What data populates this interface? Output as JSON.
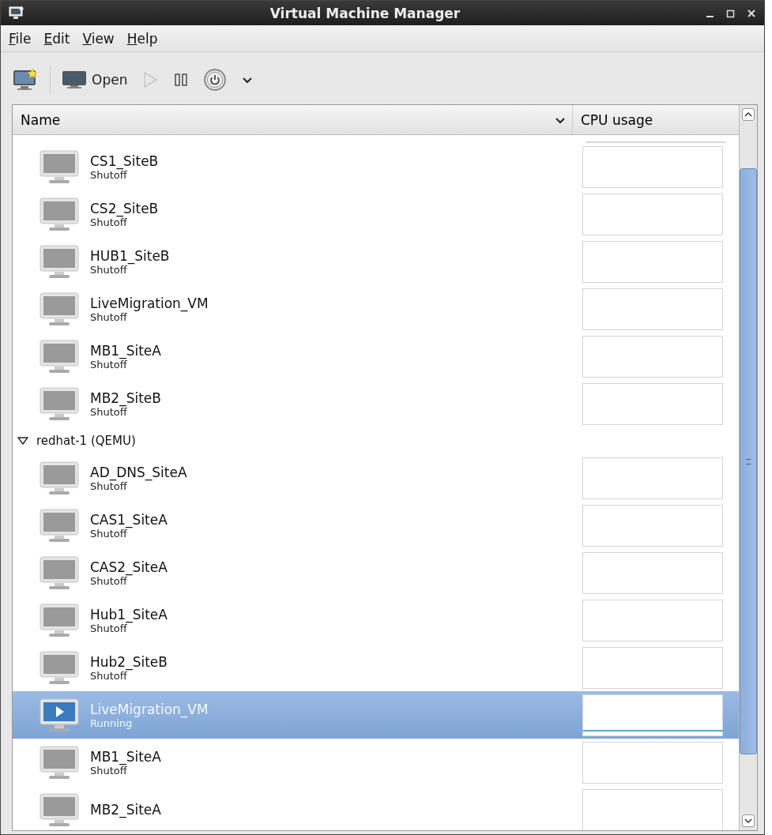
{
  "window": {
    "title": "Virtual Machine Manager"
  },
  "menu": [
    {
      "label": "File"
    },
    {
      "label": "Edit"
    },
    {
      "label": "View"
    },
    {
      "label": "Help"
    }
  ],
  "toolbar": {
    "open_label": "Open",
    "run_disabled": true
  },
  "columns": [
    {
      "label": "Name"
    },
    {
      "label": "CPU usage"
    }
  ],
  "rows": [
    {
      "kind": "vm",
      "name": "CS1_SiteB",
      "status": "Shutoff",
      "running": false,
      "selected": false
    },
    {
      "kind": "vm",
      "name": "CS2_SiteB",
      "status": "Shutoff",
      "running": false,
      "selected": false
    },
    {
      "kind": "vm",
      "name": "HUB1_SiteB",
      "status": "Shutoff",
      "running": false,
      "selected": false
    },
    {
      "kind": "vm",
      "name": "LiveMigration_VM",
      "status": "Shutoff",
      "running": false,
      "selected": false
    },
    {
      "kind": "vm",
      "name": "MB1_SiteA",
      "status": "Shutoff",
      "running": false,
      "selected": false
    },
    {
      "kind": "vm",
      "name": "MB2_SiteB",
      "status": "Shutoff",
      "running": false,
      "selected": false
    },
    {
      "kind": "host",
      "label": "redhat-1 (QEMU)",
      "expanded": true,
      "children": [
        {
          "kind": "vm",
          "name": "AD_DNS_SiteA",
          "status": "Shutoff",
          "running": false,
          "selected": false
        },
        {
          "kind": "vm",
          "name": "CAS1_SiteA",
          "status": "Shutoff",
          "running": false,
          "selected": false
        },
        {
          "kind": "vm",
          "name": "CAS2_SiteA",
          "status": "Shutoff",
          "running": false,
          "selected": false
        },
        {
          "kind": "vm",
          "name": "Hub1_SiteA",
          "status": "Shutoff",
          "running": false,
          "selected": false
        },
        {
          "kind": "vm",
          "name": "Hub2_SiteB",
          "status": "Shutoff",
          "running": false,
          "selected": false
        },
        {
          "kind": "vm",
          "name": "LiveMigration_VM",
          "status": "Running",
          "running": true,
          "selected": true
        },
        {
          "kind": "vm",
          "name": "MB1_SiteA",
          "status": "Shutoff",
          "running": false,
          "selected": false
        },
        {
          "kind": "vm",
          "name": "MB2_SiteA",
          "running": false,
          "selected": false
        }
      ]
    }
  ]
}
